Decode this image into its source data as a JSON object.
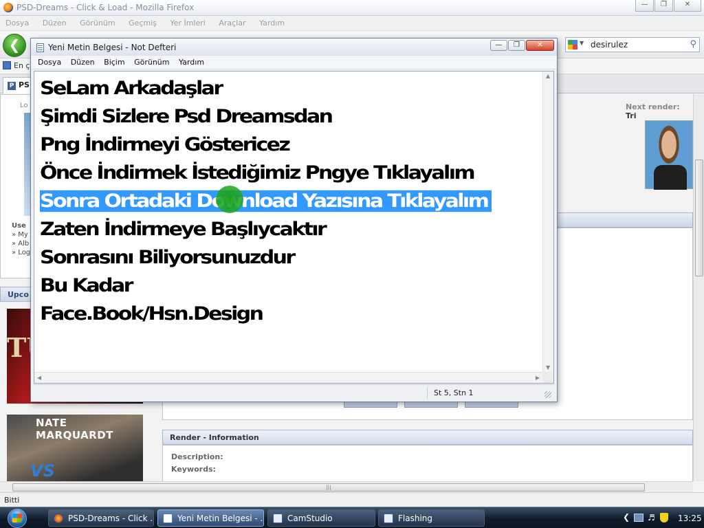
{
  "browser": {
    "title": "PSD-Dreams - Click & Load - Mozilla Firefox",
    "menu": [
      "Dosya",
      "Düzen",
      "Görünüm",
      "Geçmiş",
      "Yer İmleri",
      "Araçlar",
      "Yardım"
    ],
    "search_value": "desirulez",
    "bookmark_label": "En ç",
    "tab_label": "PS",
    "status": "Bitti"
  },
  "page": {
    "login_label": "Lo",
    "user_heading": "Use",
    "user_links": [
      "» My",
      "» Alb",
      "» Log"
    ],
    "upcoming_label": "Upco",
    "poster1_text": "TU",
    "poster2_text": "NATE MARQUARDT",
    "poster2_vs": "VS",
    "next_render_label": "Next render:",
    "next_render_value": "Tri",
    "info_header": "Render - Information",
    "info_description": "Description:",
    "info_keywords": "Keywords:"
  },
  "notepad": {
    "title": "Yeni Metin Belgesi - Not Defteri",
    "menu": [
      "Dosya",
      "Düzen",
      "Biçim",
      "Görünüm",
      "Yardım"
    ],
    "lines": [
      "SeLam Arkadaşlar",
      "Şimdi Sizlere Psd Dreamsdan",
      "Png İndirmeyi Göstericez",
      "Önce İndirmek İstediğimiz Pngye Tıklayalım",
      "Sonra Ortadaki Download Yazısına Tıklayalım",
      "Zaten İndirmeye Başlıycaktır",
      "Sonrasını Biliyorsunuzdur",
      "Bu Kadar",
      "Face.Book/Hsn.Design"
    ],
    "status_position": "St 5, Stn 1"
  },
  "taskbar": {
    "items": [
      {
        "label": "PSD-Dreams - Click ...",
        "icon": "firefox-icon"
      },
      {
        "label": "Yeni Metin Belgesi - ...",
        "icon": "notepad-icon"
      },
      {
        "label": "CamStudio",
        "icon": "camstudio-icon"
      },
      {
        "label": "Flashing",
        "icon": "flashing-icon"
      }
    ],
    "clock": "13:25"
  },
  "colors": {
    "selection": "#3399ff",
    "cursor_highlight": "#1fa01f",
    "taskbar": "#0f1c2d"
  }
}
